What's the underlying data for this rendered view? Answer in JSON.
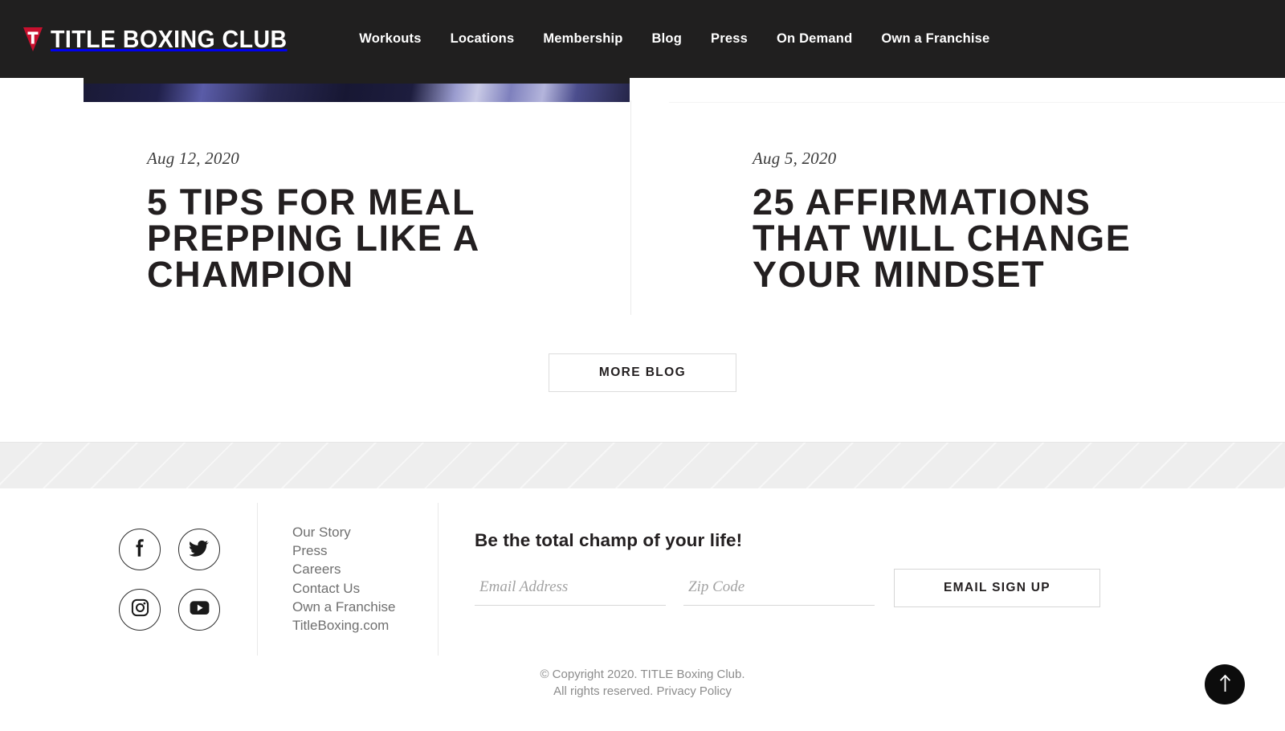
{
  "brand": {
    "logo_icon": "title-shield-icon",
    "wordmark": "TITLE BOXING CLUB",
    "accent_color": "#c8102e",
    "header_bg": "#201f1f"
  },
  "header": {
    "nav": [
      {
        "label": "Workouts"
      },
      {
        "label": "Locations"
      },
      {
        "label": "Membership"
      },
      {
        "label": "Blog"
      },
      {
        "label": "Press"
      },
      {
        "label": "On Demand"
      },
      {
        "label": "Own a Franchise"
      }
    ]
  },
  "blog": {
    "posts": [
      {
        "date": "Aug 12, 2020",
        "title": "5 TIPS FOR MEAL PREPPING LIKE A CHAMPION"
      },
      {
        "date": "Aug 5, 2020",
        "title": "25 AFFIRMATIONS THAT WILL CHANGE YOUR MINDSET"
      }
    ],
    "more_button_label": "MORE BLOG"
  },
  "footer": {
    "social": [
      {
        "name": "facebook",
        "glyph": "f"
      },
      {
        "name": "twitter",
        "glyph": "twitter-bird"
      },
      {
        "name": "instagram",
        "glyph": "instagram-camera"
      },
      {
        "name": "youtube",
        "glyph": "youtube-play"
      }
    ],
    "links": [
      {
        "label": "Our Story"
      },
      {
        "label": "Press"
      },
      {
        "label": "Careers"
      },
      {
        "label": "Contact Us"
      },
      {
        "label": "Own a Franchise"
      },
      {
        "label": "TitleBoxing.com"
      }
    ],
    "signup": {
      "heading": "Be the total champ of your life!",
      "email_value": "",
      "email_placeholder": "Email Address",
      "zip_value": "",
      "zip_placeholder": "Zip Code",
      "button_label": "EMAIL SIGN UP"
    },
    "copyright_line_1": "© Copyright 2020. TITLE Boxing Club.",
    "copyright_line_2": "All rights reserved.",
    "privacy_label": "Privacy Policy"
  },
  "back_to_top": {
    "icon": "arrow-up-icon"
  }
}
